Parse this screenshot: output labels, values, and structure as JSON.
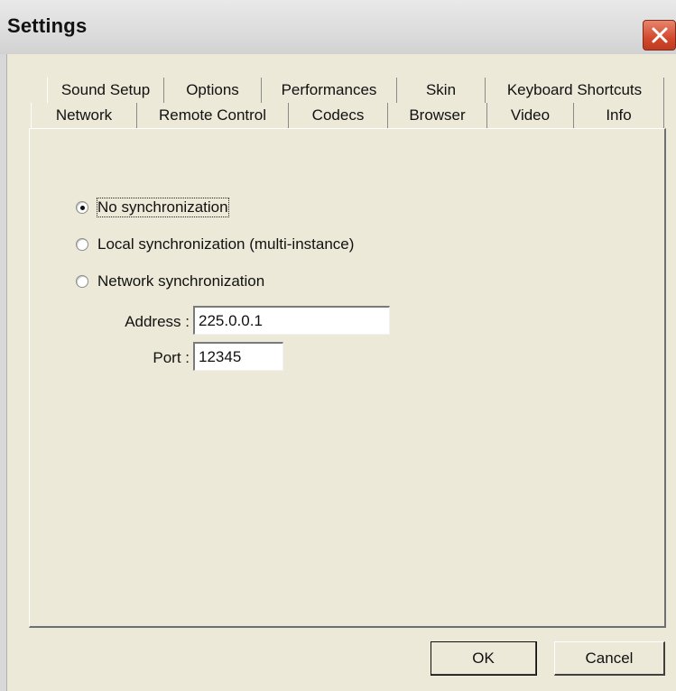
{
  "window": {
    "title": "Settings"
  },
  "tabs": {
    "row1": [
      {
        "label": "Sound Setup"
      },
      {
        "label": "Options"
      },
      {
        "label": "Performances"
      },
      {
        "label": "Skin"
      },
      {
        "label": "Keyboard Shortcuts"
      }
    ],
    "row2": [
      {
        "label": "Network",
        "selected": true
      },
      {
        "label": "Remote Control"
      },
      {
        "label": "Codecs"
      },
      {
        "label": "Browser"
      },
      {
        "label": "Video"
      },
      {
        "label": "Info"
      }
    ]
  },
  "network": {
    "options": [
      {
        "label": "No synchronization",
        "checked": true
      },
      {
        "label": "Local synchronization (multi-instance)",
        "checked": false
      },
      {
        "label": "Network synchronization",
        "checked": false
      }
    ],
    "address_label": "Address :",
    "address_value": "225.0.0.1",
    "port_label": "Port :",
    "port_value": "12345"
  },
  "buttons": {
    "ok": "OK",
    "cancel": "Cancel"
  },
  "colors": {
    "window_bg": "#ece9d8",
    "close_button": "#d24a2e"
  },
  "icons": {
    "close": "close-icon"
  }
}
